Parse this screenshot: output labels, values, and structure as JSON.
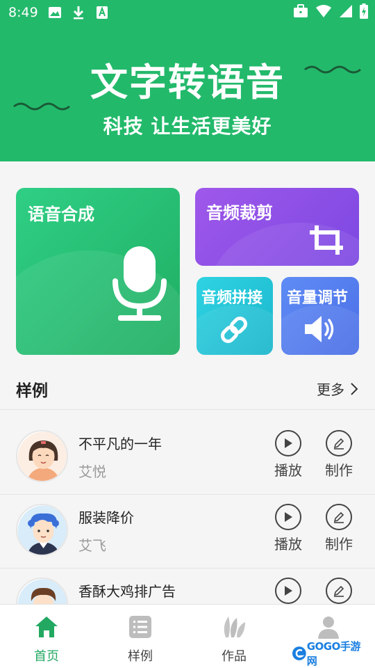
{
  "status_bar": {
    "time": "8:49",
    "left_icons": [
      "image-icon",
      "download-icon",
      "font-a-icon"
    ],
    "right_icons": [
      "briefcase-icon",
      "wifi-icon",
      "signal-icon",
      "battery-charging-icon"
    ]
  },
  "header": {
    "title": "文字转语音",
    "subtitle": "科技  让生活更美好",
    "background": "#23b96b"
  },
  "tiles": [
    {
      "label": "语音合成",
      "icon": "microphone-icon",
      "color": "#22b56a"
    },
    {
      "label": "音频裁剪",
      "icon": "crop-icon",
      "color": "#8b4fe6"
    },
    {
      "label": "音频拼接",
      "icon": "link-icon",
      "color": "#22c3d6"
    },
    {
      "label": "音量调节",
      "icon": "speaker-icon",
      "color": "#567ef0"
    }
  ],
  "samples_section": {
    "title": "样例",
    "more_label": "更多"
  },
  "samples": [
    {
      "title": "不平凡的一年",
      "author": "艾悦",
      "play_label": "播放",
      "make_label": "制作"
    },
    {
      "title": "服装降价",
      "author": "艾飞",
      "play_label": "播放",
      "make_label": "制作"
    },
    {
      "title": "香酥大鸡排广告",
      "author": "",
      "play_label": "",
      "make_label": ""
    }
  ],
  "bottom_nav": [
    {
      "label": "首页",
      "icon": "home-icon",
      "active": true
    },
    {
      "label": "样例",
      "icon": "list-icon",
      "active": false
    },
    {
      "label": "作品",
      "icon": "works-icon",
      "active": false
    },
    {
      "label": "",
      "icon": "profile-icon",
      "active": false
    }
  ],
  "watermark": {
    "text": "GOGO手游网"
  },
  "colors": {
    "accent": "#23b96b",
    "active_nav": "#23a862"
  }
}
